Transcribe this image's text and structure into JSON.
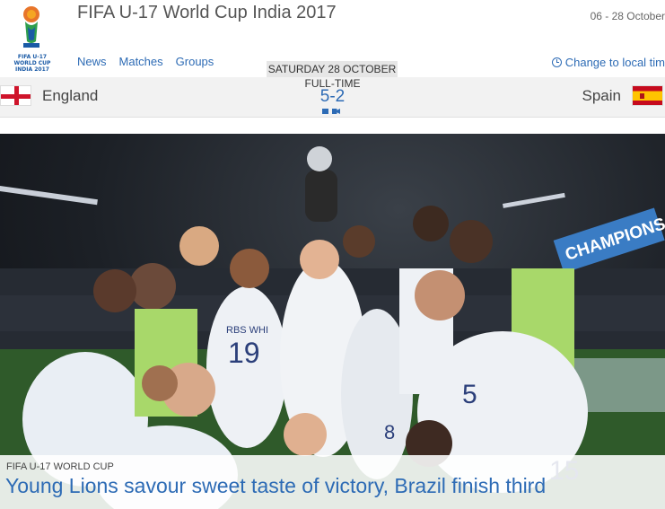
{
  "header": {
    "logo_lines": [
      "FIFA U-17 WORLD CUP",
      "INDIA 2017"
    ],
    "title": "FIFA U-17 World Cup India 2017",
    "dates": "06 - 28 October",
    "nav": [
      {
        "label": "News"
      },
      {
        "label": "Matches"
      },
      {
        "label": "Groups"
      }
    ],
    "change_time": "Change to local tim"
  },
  "match": {
    "date": "SATURDAY 28 OCTOBER",
    "status": "FULL-TIME",
    "score": "5-2",
    "home": {
      "name": "England",
      "flag": "england-flag"
    },
    "away": {
      "name": "Spain",
      "flag": "spain-flag"
    }
  },
  "hero": {
    "banner_text": "CHAMPIONS",
    "jersey_text": "RBS WHI",
    "kicker": "FIFA U-17 WORLD CUP",
    "headline": "Young Lions savour sweet taste of victory, Brazil finish third"
  },
  "colors": {
    "link": "#2d6bb5",
    "match_bar": "#f2f2f2"
  }
}
